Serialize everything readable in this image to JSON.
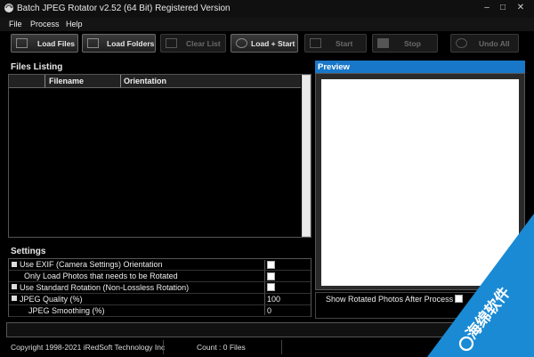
{
  "window": {
    "title": "Batch JPEG Rotator v2.52 (64 Bit) Registered Version",
    "controls": {
      "minimize": "–",
      "maximize": "□",
      "close": "✕"
    }
  },
  "menu": [
    "File",
    "Process",
    "Help"
  ],
  "toolbar": {
    "load_files": "Load Files",
    "load_folders": "Load Folders",
    "clear_list": "Clear List",
    "load_start": "Load + Start",
    "start": "Start",
    "stop": "Stop",
    "undo_all": "Undo All"
  },
  "files_listing": {
    "title": "Files Listing",
    "columns": [
      "",
      "Filename",
      "Orientation"
    ]
  },
  "settings": {
    "title": "Settings",
    "rows": [
      {
        "label": "Use EXIF (Camera Settings) Orientation",
        "value": "",
        "checked": false
      },
      {
        "label": "Only Load Photos that needs to be Rotated",
        "value": "",
        "checked": false
      },
      {
        "label": "Use Standard Rotation (Non-Lossless Rotation)",
        "value": "",
        "checked": false
      },
      {
        "label": "JPEG Quality (%)",
        "value": "100"
      },
      {
        "label": "JPEG Smoothing (%)",
        "value": "0"
      }
    ]
  },
  "preview": {
    "title": "Preview",
    "show_rotated": "Show Rotated Photos After Process"
  },
  "status": {
    "copyright": "Copyright 1998-2021 iRedSoft Technology Inc",
    "count": "Count : 0 Files"
  },
  "watermark": {
    "text": "海绵软件"
  },
  "colors": {
    "accent": "#1877c8",
    "background": "#000000",
    "watermark": "#1a8ad4"
  }
}
